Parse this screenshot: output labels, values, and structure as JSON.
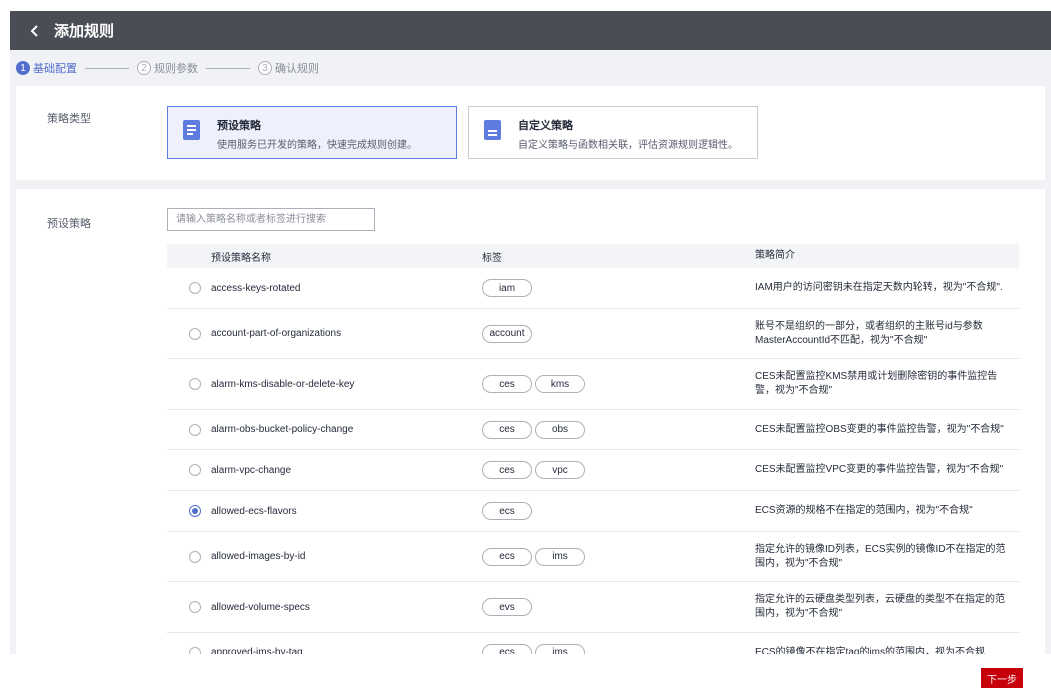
{
  "header": {
    "title": "添加规则"
  },
  "steps": [
    {
      "num": "1",
      "label": "基础配置",
      "active": true
    },
    {
      "num": "2",
      "label": "规则参数",
      "active": false
    },
    {
      "num": "3",
      "label": "确认规则",
      "active": false
    }
  ],
  "policy_type": {
    "label": "策略类型",
    "options": [
      {
        "title": "预设策略",
        "desc": "使用服务已开发的策略，快速完成规则创建。",
        "selected": true,
        "icon": "list-doc-icon"
      },
      {
        "title": "自定义策略",
        "desc": "自定义策略与函数相关联，评估资源规则逻辑性。",
        "selected": false,
        "icon": "custom-doc-icon"
      }
    ]
  },
  "preset": {
    "label": "预设策略",
    "search_placeholder": "请输入策略名称或者标签进行搜索",
    "columns": {
      "name": "预设策略名称",
      "tags": "标签",
      "desc": "策略简介"
    },
    "rows": [
      {
        "name": "access-keys-rotated",
        "tags": [
          "iam"
        ],
        "desc": "IAM用户的访问密钥未在指定天数内轮转，视为\"不合规\".",
        "checked": false
      },
      {
        "name": "account-part-of-organizations",
        "tags": [
          "account"
        ],
        "desc": "账号不是组织的一部分，或者组织的主账号id与参数MasterAccountId不匹配，视为\"不合规\"",
        "checked": false
      },
      {
        "name": "alarm-kms-disable-or-delete-key",
        "tags": [
          "ces",
          "kms"
        ],
        "desc": "CES未配置监控KMS禁用或计划删除密钥的事件监控告警，视为\"不合规\"",
        "checked": false
      },
      {
        "name": "alarm-obs-bucket-policy-change",
        "tags": [
          "ces",
          "obs"
        ],
        "desc": "CES未配置监控OBS变更的事件监控告警，视为\"不合规\"",
        "checked": false
      },
      {
        "name": "alarm-vpc-change",
        "tags": [
          "ces",
          "vpc"
        ],
        "desc": "CES未配置监控VPC变更的事件监控告警，视为\"不合规\"",
        "checked": false
      },
      {
        "name": "allowed-ecs-flavors",
        "tags": [
          "ecs"
        ],
        "desc": "ECS资源的规格不在指定的范围内，视为\"不合规\"",
        "checked": true
      },
      {
        "name": "allowed-images-by-id",
        "tags": [
          "ecs",
          "ims"
        ],
        "desc": "指定允许的镜像ID列表，ECS实例的镜像ID不在指定的范围内，视为\"不合规\"",
        "checked": false
      },
      {
        "name": "allowed-volume-specs",
        "tags": [
          "evs"
        ],
        "desc": "指定允许的云硬盘类型列表，云硬盘的类型不在指定的范围内，视为\"不合规\"",
        "checked": false
      },
      {
        "name": "approved-ims-by-tag",
        "tags": [
          "ecs",
          "ims"
        ],
        "desc": "ECS的镜像不在指定tag的ims的范围内，视为不合规",
        "checked": false
      }
    ]
  },
  "footer": {
    "next_label": "下一步"
  },
  "colors": {
    "header_bg": "#4a4d56",
    "accent": "#526ecc",
    "next_button": "#c7000b"
  }
}
